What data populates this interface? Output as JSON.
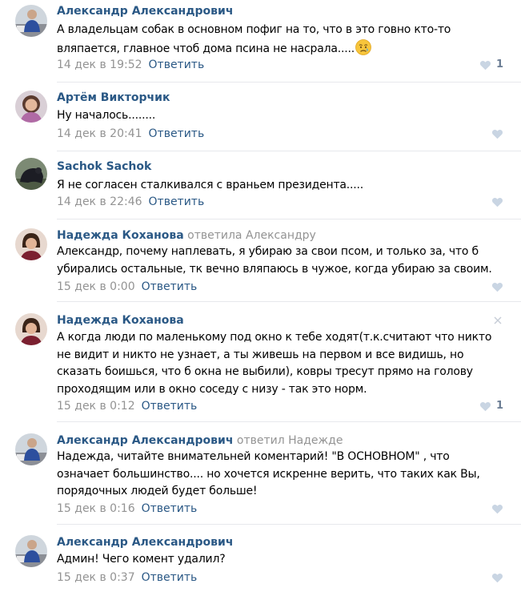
{
  "colors": {
    "link": "#2a5885",
    "muted": "#939393",
    "divider": "#e7e8ec",
    "like_heart": "#c9d5e3"
  },
  "comments": [
    {
      "author": "Александр Александрович",
      "reply_to": "",
      "text": "А владельцам собак в основном пофиг на то, что в это говно кто-то вляпается, главное чтоб дома псина не насрала.....",
      "emoji_icon": "sad-face-emoji-icon",
      "date": "14 дек в 19:52",
      "reply_label": "Ответить",
      "likes": "1"
    },
    {
      "author": "Артём Викторчик",
      "reply_to": "",
      "text": "Ну началось........",
      "date": "14 дек в 20:41",
      "reply_label": "Ответить",
      "likes": ""
    },
    {
      "author": "Sachok Sachok",
      "reply_to": "",
      "text": "Я не согласен сталкивался с враньем президента.....",
      "date": "14 дек в 22:46",
      "reply_label": "Ответить",
      "likes": ""
    },
    {
      "author": "Надежда Коханова",
      "reply_to": "ответила Александру",
      "text": "Александр, почему наплевать, я убираю за свои псом, и только за, что б убирались остальные, тк вечно вляпаюсь в чужое, когда убираю за своим.",
      "date": "15 дек в 0:00",
      "reply_label": "Ответить",
      "likes": ""
    },
    {
      "author": "Надежда Коханова",
      "reply_to": "",
      "text": "А когда люди по маленькому под окно к тебе ходят(т.к.считают что никто не видит и никто не узнает, а ты живешь на первом и все видишь, но сказать боишься, что б окна не выбили), ковры тресут прямо на голову проходящим или в окно соседу с низу - так это норм.",
      "date": "15 дек в 0:12",
      "reply_label": "Ответить",
      "likes": "1"
    },
    {
      "author": "Александр Александрович",
      "reply_to": "ответил Надежде",
      "text": "Надежда, читайте внимательней коментарий! \"В ОСНОВНОМ\" , что означает большинство.... но хочется искренне верить, что таких как Вы, порядочных людей будет больше!",
      "date": "15 дек в 0:16",
      "reply_label": "Ответить",
      "likes": ""
    },
    {
      "author": "Александр Александрович",
      "reply_to": "",
      "text": "Админ! Чего комент удалил?",
      "date": "15 дек в 0:37",
      "reply_label": "Ответить",
      "likes": ""
    }
  ]
}
